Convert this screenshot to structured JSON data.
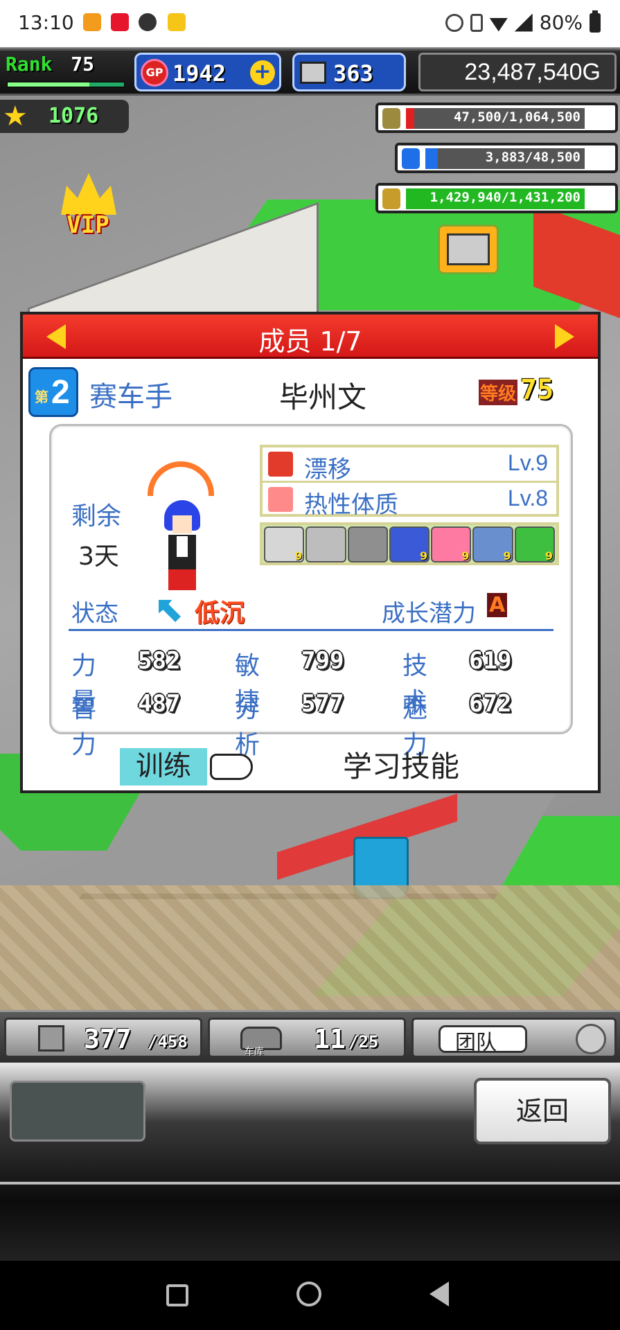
{
  "status_bar": {
    "time": "13:10",
    "battery": "80%"
  },
  "hud": {
    "rank_label": "Rank",
    "rank_value": "75",
    "rank_progress": 0.7,
    "gp_label": "GP",
    "gp_value": "1942",
    "gp_plus": "+",
    "pc_value": "363",
    "money": "23,487,540G",
    "stars": "1076",
    "resources": [
      {
        "name": "fuel-resource",
        "text": "47,500/1,064,500",
        "fraction": 0.045,
        "color": "#e02020",
        "icon_color": "#9c8a3e"
      },
      {
        "name": "tank-resource",
        "text": "3,883/48,500",
        "fraction": 0.08,
        "color": "#1e6fe8",
        "icon_color": "#1e6fe8"
      },
      {
        "name": "research-resource",
        "text": "1,429,940/1,431,200",
        "fraction": 0.999,
        "color": "#22b822",
        "icon_color": "#c79c2a"
      }
    ],
    "vip_label": "VIP"
  },
  "dialog": {
    "title": "成员 1/7",
    "rank_prefix": "第",
    "rank_number": "2",
    "role": "赛车手",
    "name": "毕州文",
    "level_label": "等级",
    "level_value": "75",
    "remaining_label": "剩余",
    "remaining_value": "3天",
    "skills": [
      {
        "name": "漂移",
        "level": "Lv.9",
        "icon_color": "#e23b2c"
      },
      {
        "name": "热性体质",
        "level": "Lv.8",
        "icon_color": "#ff8a8a"
      }
    ],
    "gear": [
      {
        "label": "9",
        "color": "#d6d6d6"
      },
      {
        "label": "",
        "color": "#bdbdbd"
      },
      {
        "label": "",
        "color": "#8f8f8f"
      },
      {
        "label": "9",
        "color": "#3b5ad8"
      },
      {
        "label": "9",
        "color": "#ff7aa3"
      },
      {
        "label": "9",
        "color": "#6a8fcf"
      },
      {
        "label": "9",
        "color": "#3fbf3f"
      }
    ],
    "condition_label": "状态",
    "condition_value": "低沉",
    "potential_label": "成长潜力",
    "potential_value": "A",
    "stats": [
      {
        "key": "力量",
        "value": "582"
      },
      {
        "key": "敏捷",
        "value": "799"
      },
      {
        "key": "技术",
        "value": "619"
      },
      {
        "key": "智力",
        "value": "487"
      },
      {
        "key": "分析",
        "value": "577"
      },
      {
        "key": "魅力",
        "value": "672"
      }
    ],
    "train_label": "训练",
    "learn_label": "学习技能"
  },
  "bottom": {
    "parts_value": "377",
    "parts_max": "/458",
    "garage_label": "车库",
    "garage_value": "11",
    "garage_max": "/25",
    "team_label": "团队",
    "back_label": "返回"
  }
}
